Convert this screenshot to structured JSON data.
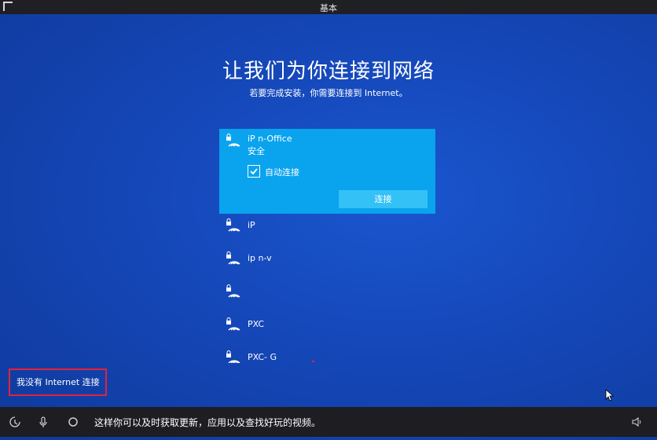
{
  "window": {
    "title": "基本"
  },
  "page": {
    "heading": "让我们为你连接到网络",
    "subheading": "若要完成安装，你需要连接到 Internet。"
  },
  "selected_network": {
    "name": "iP   n-Office",
    "security": "安全",
    "auto_connect_label": "自动连接",
    "auto_connect_checked": true,
    "connect_label": "连接"
  },
  "networks": [
    {
      "name": "iP"
    },
    {
      "name": "ip   n-v"
    },
    {
      "name": ""
    },
    {
      "name": "PXC"
    },
    {
      "name": "PXC-  G"
    }
  ],
  "no_internet_label": "我没有 Internet 连接",
  "taskbar": {
    "hint": "这样你可以及时获取更新，应用以及查找好玩的视频。"
  },
  "colors": {
    "background": "#1547b8",
    "selected_network": "#0aa3ee",
    "connect_button": "#34c1f6",
    "highlight_box": "#e0233e"
  }
}
